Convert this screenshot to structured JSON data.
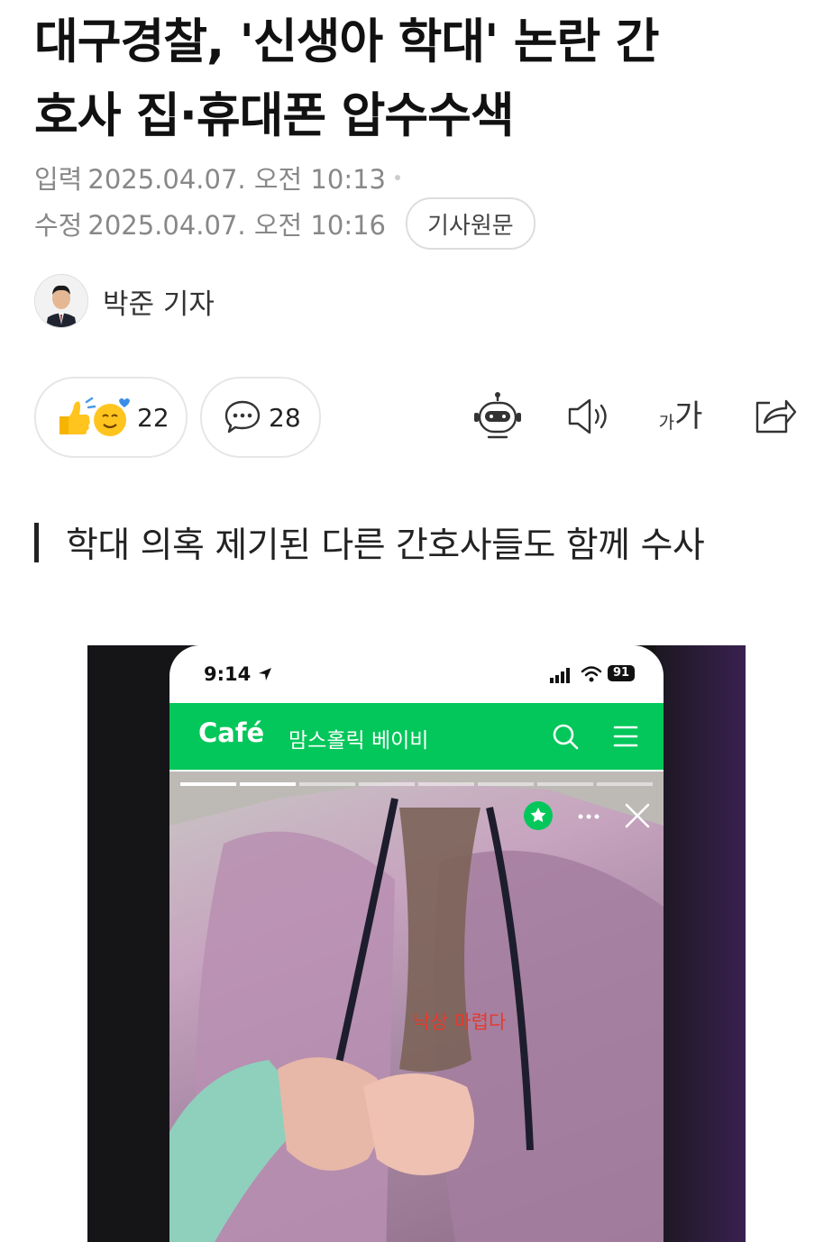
{
  "article": {
    "title_line1": "대구경찰, '신생아 학대' 논란 간",
    "title_line2": "호사 집·휴대폰 압수수색",
    "published_label": "입력",
    "published": "2025.04.07. 오전 10:13",
    "modified_label": "수정",
    "modified": "2025.04.07. 오전 10:16",
    "original_button": "기사원문",
    "reporter": "박준 기자",
    "subheading": "학대 의혹 제기된 다른 간호사들도 함께 수사"
  },
  "actions": {
    "reaction_count": "22",
    "comment_count": "28",
    "font_size_label_small": "가",
    "font_size_label_large": "가"
  },
  "photo": {
    "status_time": "9:14",
    "battery": "91",
    "cafe_logo": "Café",
    "cafe_name": "맘스홀릭 베이비",
    "caption": "낙상 마렵다"
  },
  "colors": {
    "cafe_green": "#03c75a",
    "caption_red": "#e53a2c",
    "meta_gray": "#888888"
  },
  "icons": [
    "profile-avatar-icon",
    "reaction-emoji-icon",
    "comment-icon",
    "ai-robot-icon",
    "speaker-icon",
    "font-size-icon",
    "share-icon",
    "location-arrow-icon",
    "signal-icon",
    "wifi-icon",
    "battery-icon",
    "search-icon",
    "menu-icon",
    "favorite-star-icon",
    "more-icon",
    "close-icon"
  ]
}
